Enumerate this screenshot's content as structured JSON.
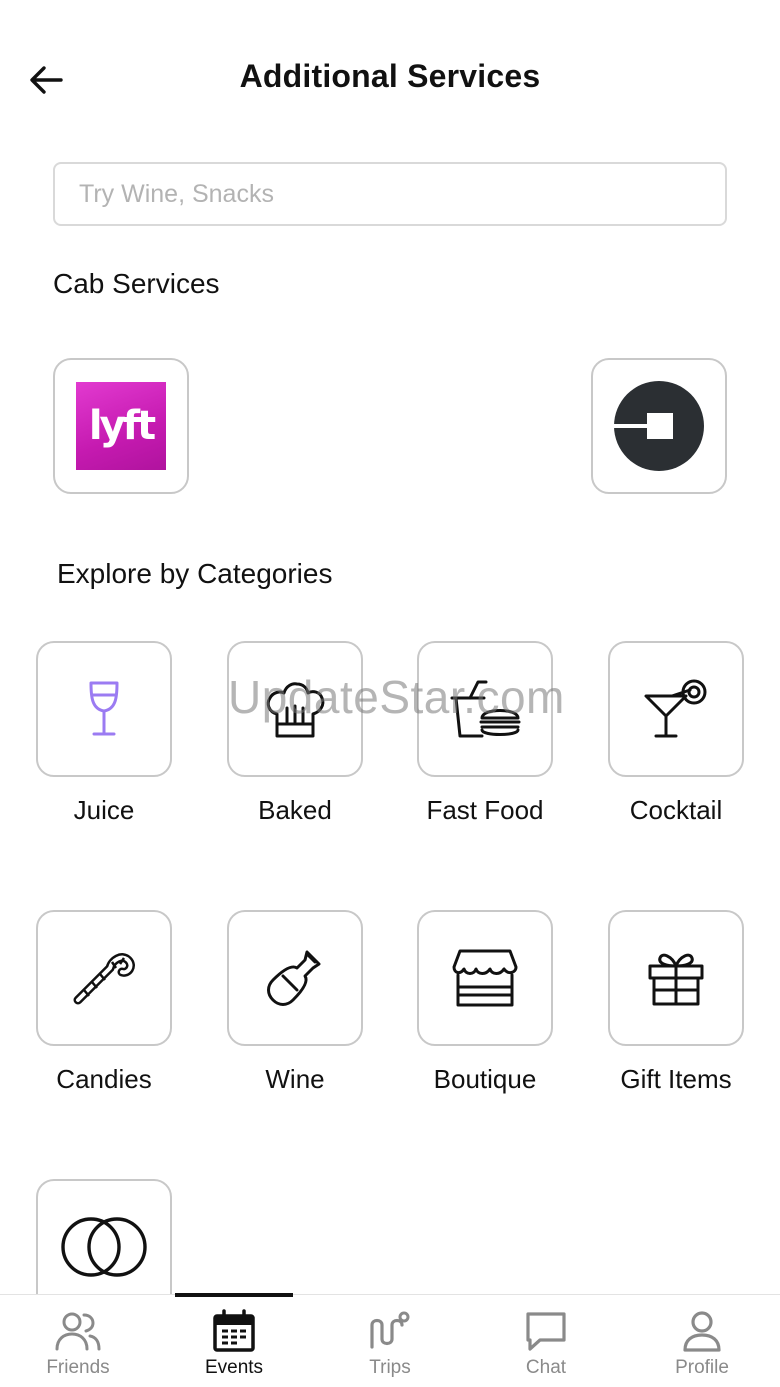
{
  "header": {
    "title": "Additional Services",
    "back_icon": "arrow-left-icon"
  },
  "search": {
    "placeholder": "Try Wine, Snacks",
    "value": ""
  },
  "cab_services": {
    "title": "Cab Services",
    "providers": [
      {
        "name": "lyft",
        "logo_text": "lyft",
        "color": "#d42bc0"
      },
      {
        "name": "uber",
        "color": "#2b2f33"
      }
    ]
  },
  "categories": {
    "title": "Explore by Categories",
    "items": [
      {
        "label": "Juice",
        "icon": "wine-glass-icon"
      },
      {
        "label": "Baked",
        "icon": "chef-hat-icon"
      },
      {
        "label": "Fast Food",
        "icon": "fast-food-icon"
      },
      {
        "label": "Cocktail",
        "icon": "cocktail-icon"
      },
      {
        "label": "Candies",
        "icon": "candy-cane-icon"
      },
      {
        "label": "Wine",
        "icon": "wine-bottle-icon"
      },
      {
        "label": "Boutique",
        "icon": "storefront-icon"
      },
      {
        "label": "Gift Items",
        "icon": "gift-icon"
      },
      {
        "label": "",
        "icon": "rings-icon"
      }
    ]
  },
  "watermark": "UpdateStar.com",
  "tabbar": {
    "active": "Events",
    "tabs": [
      {
        "label": "Friends",
        "icon": "friends-icon"
      },
      {
        "label": "Events",
        "icon": "calendar-icon"
      },
      {
        "label": "Trips",
        "icon": "route-icon"
      },
      {
        "label": "Chat",
        "icon": "chat-icon"
      },
      {
        "label": "Profile",
        "icon": "profile-icon"
      }
    ]
  },
  "colors": {
    "accent_purple": "#9b7bf2",
    "text": "#111111",
    "muted": "#8a8a8a",
    "border": "#c8c8c8"
  }
}
